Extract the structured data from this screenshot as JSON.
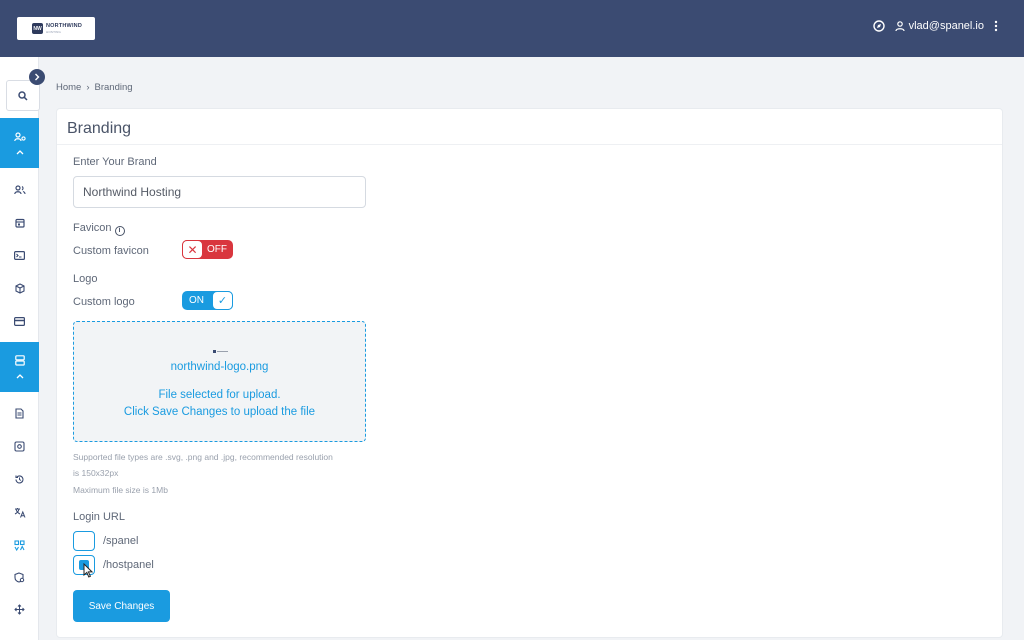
{
  "header": {
    "logo_text": "NORTHWIND",
    "logo_sub": "HOSTING",
    "logo_mark": "NW",
    "user_email": "vlad@spanel.io"
  },
  "breadcrumb": {
    "home": "Home",
    "separator": "›",
    "current": "Branding"
  },
  "card": {
    "title": "Branding"
  },
  "brand": {
    "label": "Enter Your Brand",
    "value": "Northwind Hosting"
  },
  "favicon": {
    "section_label": "Favicon",
    "toggle_label": "Custom favicon",
    "toggle_state": "OFF"
  },
  "logo": {
    "section_label": "Logo",
    "toggle_label": "Custom logo",
    "toggle_state": "ON"
  },
  "upload": {
    "file_name": "northwind-logo.png",
    "message_line1": "File selected for upload.",
    "message_line2": "Click Save Changes to upload the file",
    "hint_line1": "Supported file types are .svg, .png and .jpg, recommended resolution",
    "hint_line2": "is 150x32px",
    "hint_line3": "Maximum file size is 1Mb"
  },
  "login_url": {
    "label": "Login URL",
    "options": [
      {
        "label": "/spanel",
        "checked": false
      },
      {
        "label": "/hostpanel",
        "checked": true
      }
    ]
  },
  "actions": {
    "save_label": "Save Changes"
  },
  "colors": {
    "topbar": "#3b4b72",
    "accent": "#1a9be0",
    "danger": "#d9363e"
  }
}
